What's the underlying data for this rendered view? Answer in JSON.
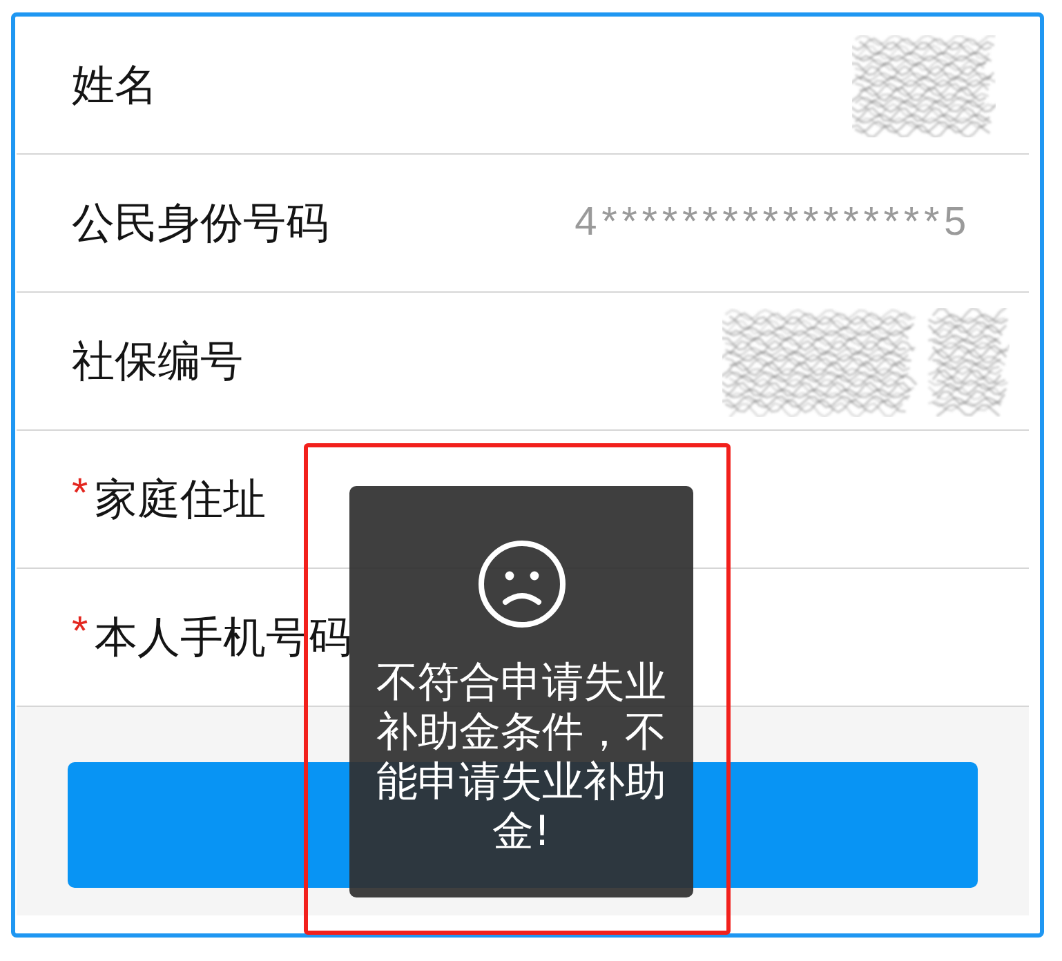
{
  "form": {
    "rows": [
      {
        "label": "姓名",
        "redacted": true
      },
      {
        "label": "公民身份号码",
        "value": "4*****************5"
      },
      {
        "label": "社保编号",
        "redacted": true
      },
      {
        "label": "家庭住址",
        "required_mark": "*"
      },
      {
        "label": "本人手机号码",
        "required_mark": "*"
      }
    ]
  },
  "toast": {
    "message": "不符合申请失业补助金条件，不能申请失业补助金!"
  }
}
